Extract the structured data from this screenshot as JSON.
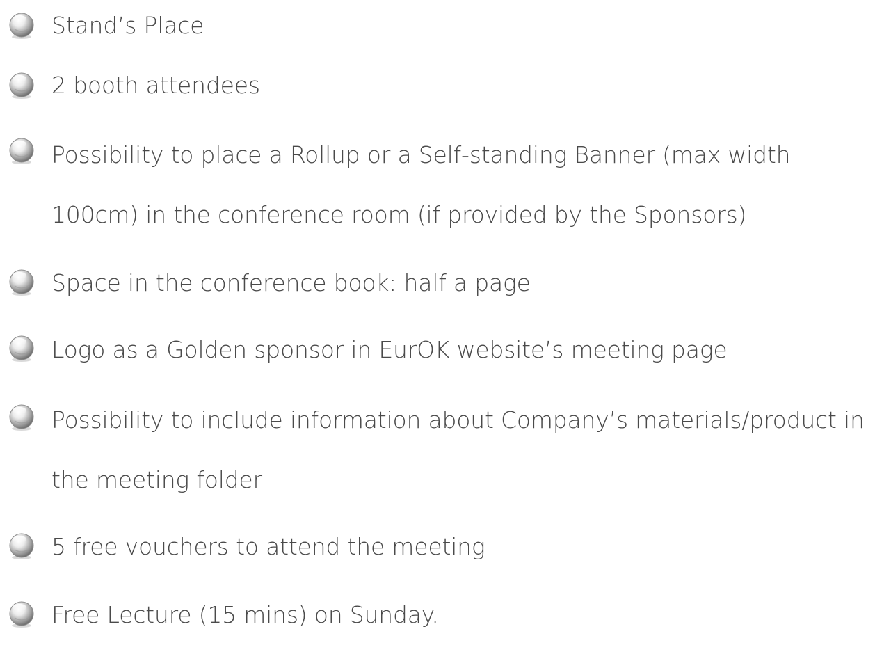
{
  "benefits": [
    {
      "text": "Stand’s Place",
      "icon": "pearl-bullet-icon"
    },
    {
      "text": "2 booth attendees",
      "icon": "pearl-bullet-icon"
    },
    {
      "text": "Possibility to place a Rollup or a Self-standing Banner (max width 100cm) in the conference room (if provided by the Sponsors)",
      "icon": "pearl-bullet-icon"
    },
    {
      "text": "Space in the conference book: half a page",
      "icon": "pearl-bullet-icon"
    },
    {
      "text": "Logo as a Golden sponsor in EurOK website’s meeting page",
      "icon": "pearl-bullet-icon"
    },
    {
      "text": "Possibility to include information about Company’s materials/product in the meeting folder",
      "icon": "pearl-bullet-icon"
    },
    {
      "text": "5 free vouchers to attend the meeting",
      "icon": "pearl-bullet-icon"
    },
    {
      "text": "Free Lecture (15 mins) on Sunday.",
      "icon": "pearl-bullet-icon"
    }
  ]
}
